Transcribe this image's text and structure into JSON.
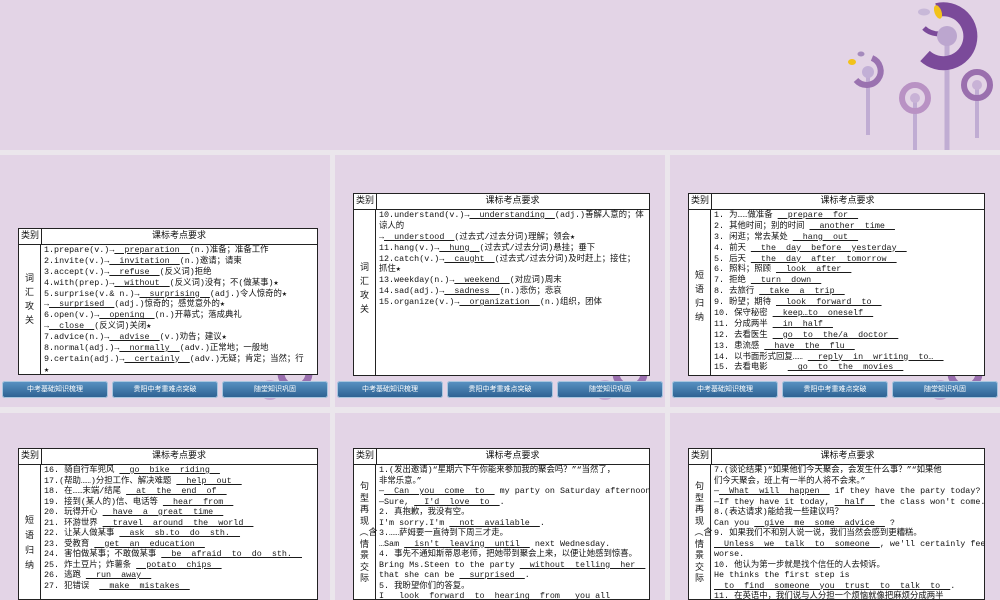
{
  "header": {
    "category": "类别",
    "requirement": "课标考点要求"
  },
  "nav": [
    "中考基础知识梳理",
    "贵阳中考重难点突破",
    "随堂知识巩固"
  ],
  "colors": {
    "slide_bg": "#e3d4e6",
    "accent_purple": "#7b4a9a",
    "nav_blue": "#2c5f90",
    "leaf_yellow": "#f2c21b"
  },
  "panels": [
    {
      "category": "词汇攻关",
      "lines": [
        [
          [
            "1.prepare(v.)→",
            0
          ],
          [
            "  preparation  ",
            1
          ],
          [
            "(n.)准备；准备工作",
            0
          ]
        ],
        [
          [
            "2.invite(v.)→",
            0
          ],
          [
            "  invitation  ",
            1
          ],
          [
            "(n.)邀请；请柬",
            0
          ]
        ],
        [
          [
            "3.accept(v.)→",
            0
          ],
          [
            "  refuse  ",
            1
          ],
          [
            "(反义词)拒绝",
            0
          ]
        ],
        [
          [
            "4.with(prep.)→",
            0
          ],
          [
            "  without  ",
            1
          ],
          [
            "(反义词)没有；不(做某事)★",
            0
          ]
        ],
        [
          [
            "5.surprise(v.& n.)→",
            0
          ],
          [
            "  surprising  ",
            1
          ],
          [
            "(adj.)令人惊奇的★",
            0
          ]
        ],
        [
          [
            "→",
            0
          ],
          [
            "  surprised  ",
            1
          ],
          [
            "(adj.)惊奇的；感觉意外的★",
            0
          ]
        ],
        [
          [
            "6.open(v.)→",
            0
          ],
          [
            "  opening  ",
            1
          ],
          [
            "(n.)开幕式；落成典礼",
            0
          ]
        ],
        [
          [
            "→",
            0
          ],
          [
            "  close  ",
            1
          ],
          [
            "(反义词)关闭★",
            0
          ]
        ],
        [
          [
            "7.advice(n.)→",
            0
          ],
          [
            "  advise  ",
            1
          ],
          [
            "(v.)劝告；建议★",
            0
          ]
        ],
        [
          [
            "8.normal(adj.)→",
            0
          ],
          [
            "  normally  ",
            1
          ],
          [
            "(adv.)正常地；一般地",
            0
          ]
        ],
        [
          [
            "9.certain(adj.)→",
            0
          ],
          [
            "  certainly  ",
            1
          ],
          [
            "(adv.)无疑；肯定；当然；行",
            0
          ]
        ],
        [
          [
            "★",
            0
          ]
        ]
      ]
    },
    {
      "category": "词汇攻关",
      "lines": [
        [
          [
            "10.understand(v.)→",
            0
          ],
          [
            "  understanding  ",
            1
          ],
          [
            "(adj.)善解人意的；体",
            0
          ]
        ],
        [
          [
            "谅人的",
            0
          ]
        ],
        [
          [
            "→",
            0
          ],
          [
            "  understood  ",
            1
          ],
          [
            "(过去式/过去分词)理解；领会★",
            0
          ]
        ],
        [
          [
            "11.hang(v.)→",
            0
          ],
          [
            "  hung  ",
            1
          ],
          [
            "(过去式/过去分词)悬挂；垂下",
            0
          ]
        ],
        [
          [
            "12.catch(v.)→",
            0
          ],
          [
            "  caught  ",
            1
          ],
          [
            "(过去式/过去分词)及时赶上；接住；",
            0
          ]
        ],
        [
          [
            "抓住★",
            0
          ]
        ],
        [
          [
            "13.weekday(n.)→",
            0
          ],
          [
            "  weekend  ",
            1
          ],
          [
            "(对应词)周末",
            0
          ]
        ],
        [
          [
            "14.sad(adj.)→",
            0
          ],
          [
            "  sadness  ",
            1
          ],
          [
            "(n.)悲伤；悲哀",
            0
          ]
        ],
        [
          [
            "15.organize(v.)→",
            0
          ],
          [
            "  organization  ",
            1
          ],
          [
            "(n.)组织，团体",
            0
          ]
        ]
      ]
    },
    {
      "category": "短语归纳",
      "lines": [
        [
          [
            "1. 为……做准备 ",
            0
          ],
          [
            "  prepare  for  ",
            1
          ]
        ],
        [
          [
            "2. 其他时间；别的时间 ",
            0
          ],
          [
            "  another  time  ",
            1
          ]
        ],
        [
          [
            "3. 闲逛；常去某处 ",
            0
          ],
          [
            "  hang  out  ",
            1
          ]
        ],
        [
          [
            "4. 前天 ",
            0
          ],
          [
            "  the  day  before  yesterday  ",
            1
          ]
        ],
        [
          [
            "5. 后天 ",
            0
          ],
          [
            "  the  day  after  tomorrow  ",
            1
          ]
        ],
        [
          [
            "6. 照料；照顾 ",
            0
          ],
          [
            "  look  after  ",
            1
          ]
        ],
        [
          [
            "7. 拒绝 ",
            0
          ],
          [
            "  turn  down  ",
            1
          ]
        ],
        [
          [
            "8. 去旅行 ",
            0
          ],
          [
            "  take  a  trip  ",
            1
          ]
        ],
        [
          [
            "9. 盼望；期待 ",
            0
          ],
          [
            "  look  forward  to  ",
            1
          ]
        ],
        [
          [
            "10. 保守秘密 ",
            0
          ],
          [
            "  keep…to  oneself  ",
            1
          ]
        ],
        [
          [
            "11. 分成两半 ",
            0
          ],
          [
            "  in  half  ",
            1
          ]
        ],
        [
          [
            "12. 去看医生 ",
            0
          ],
          [
            "  go  to  the/a  doctor  ",
            1
          ]
        ],
        [
          [
            "13. 患流感 ",
            0
          ],
          [
            "  have  the  flu  ",
            1
          ]
        ],
        [
          [
            "14. 以书面形式回复…… ",
            0
          ],
          [
            "  reply  in  writing  to…  ",
            1
          ]
        ],
        [
          [
            "15. 去看电影    ",
            0
          ],
          [
            "  go  to  the  movies  ",
            1
          ]
        ]
      ]
    },
    {
      "category": "短语归纳",
      "lines": [
        [
          [
            "16. 骑自行车兜风 ",
            0
          ],
          [
            "  go  bike  riding  ",
            1
          ]
        ],
        [
          [
            "17.(帮助……)分担工作、解决难题 ",
            0
          ],
          [
            "  help  out  ",
            1
          ]
        ],
        [
          [
            "18. 在……末端/结尾 ",
            0
          ],
          [
            "  at  the  end  of  ",
            1
          ]
        ],
        [
          [
            "19. 接到(某人的)信、电话等 ",
            0
          ],
          [
            "  hear  from  ",
            1
          ]
        ],
        [
          [
            "20. 玩得开心 ",
            0
          ],
          [
            "  have  a  great  time  ",
            1
          ]
        ],
        [
          [
            "21. 环游世界 ",
            0
          ],
          [
            "  travel  around  the  world  ",
            1
          ]
        ],
        [
          [
            "22. 让某人做某事 ",
            0
          ],
          [
            "  ask  sb.to  do  sth.  ",
            1
          ]
        ],
        [
          [
            "23. 受教育 ",
            0
          ],
          [
            "  get  an  education  ",
            1
          ]
        ],
        [
          [
            "24. 害怕做某事；不敢做某事 ",
            0
          ],
          [
            "  be  afraid  to  do  sth.  ",
            1
          ]
        ],
        [
          [
            "25. 炸土豆片；炸薯条 ",
            0
          ],
          [
            "  potato  chips  ",
            1
          ]
        ],
        [
          [
            "26. 逃跑 ",
            0
          ],
          [
            "  run  away  ",
            1
          ]
        ],
        [
          [
            "27. 犯错误  ",
            0
          ],
          [
            "  make  mistakes  ",
            1
          ]
        ]
      ]
    },
    {
      "category": "句型再现︵含情景交际",
      "lines": [
        [
          [
            "1.(发出邀请)“星期六下午你能来参加我的聚会吗？”“当然了，",
            0
          ]
        ],
        [
          [
            "非常乐意。”",
            0
          ]
        ],
        [
          [
            "—",
            0
          ],
          [
            "  Can  you  come  to  ",
            1
          ],
          [
            " my party on Saturday afternoon?",
            0
          ]
        ],
        [
          [
            "—Sure, ",
            0
          ],
          [
            "  I'd  love  to  ",
            1
          ],
          [
            ".",
            0
          ]
        ],
        [
          [
            "2. 真抱歉，我没有空。",
            0
          ]
        ],
        [
          [
            "I'm sorry.I'm ",
            0
          ],
          [
            "  not  available  ",
            1
          ],
          [
            ".",
            0
          ]
        ],
        [
          [
            "3.……萨姆要一直待到下周三才走。",
            0
          ]
        ],
        [
          [
            "…Sam ",
            0
          ],
          [
            "  isn't  leaving  until  ",
            1
          ],
          [
            " next Wednesday.",
            0
          ]
        ],
        [
          [
            "4. 事先不通知斯蒂恩老师，把她带到聚会上来，以便让她感到惊喜。",
            0
          ]
        ],
        [
          [
            "Bring Ms.Steen to the party ",
            0
          ],
          [
            "  without  telling  her  ",
            1
          ],
          [
            " so",
            0
          ]
        ],
        [
          [
            "that she can be ",
            0
          ],
          [
            "  surprised  ",
            1
          ],
          [
            ".",
            0
          ]
        ],
        [
          [
            "5. 我盼望你们的答复。",
            0
          ]
        ],
        [
          [
            "I ",
            0
          ],
          [
            "  look  forward  to  hearing  from  ",
            1
          ],
          [
            " you all",
            0
          ]
        ]
      ]
    },
    {
      "category": "句型再现︵含情景交际",
      "lines": [
        [
          [
            "7.(谈论结果)“如果他们今天聚会，会发生什么事？”“如果他",
            0
          ]
        ],
        [
          [
            "们今天聚会，班上有一半的人将不会来。”",
            0
          ]
        ],
        [
          [
            "—",
            0
          ],
          [
            "  What  will  happen  ",
            1
          ],
          [
            " if they have the party today?",
            0
          ]
        ],
        [
          [
            "—If they have it today, ",
            0
          ],
          [
            "  half  ",
            1
          ],
          [
            " the class won't come.",
            0
          ]
        ],
        [
          [
            "8.(表达请求)能给我一些建议吗？",
            0
          ]
        ],
        [
          [
            "Can you ",
            0
          ],
          [
            "  give  me  some  advice  ",
            1
          ],
          [
            " ?",
            0
          ]
        ],
        [
          [
            "9. 如果我们不和别人说一说，我们当然会感到更糟糕。",
            0
          ]
        ],
        [
          [
            "",
            0
          ],
          [
            "  Unless  we  talk  to  someone  ",
            1
          ],
          [
            ", we'll certainly feel",
            0
          ]
        ],
        [
          [
            "worse.",
            0
          ]
        ],
        [
          [
            "10. 他认为第一步就是找个信任的人去倾诉。",
            0
          ]
        ],
        [
          [
            "He thinks the first step is",
            0
          ]
        ],
        [
          [
            "",
            0
          ],
          [
            "  to  find  someone  you  trust  to  talk  to  ",
            1
          ],
          [
            ".",
            0
          ]
        ],
        [
          [
            "11. 在英语中，我们说与人分担一个烦恼就像把麻烦分成两半",
            0
          ]
        ]
      ]
    }
  ]
}
